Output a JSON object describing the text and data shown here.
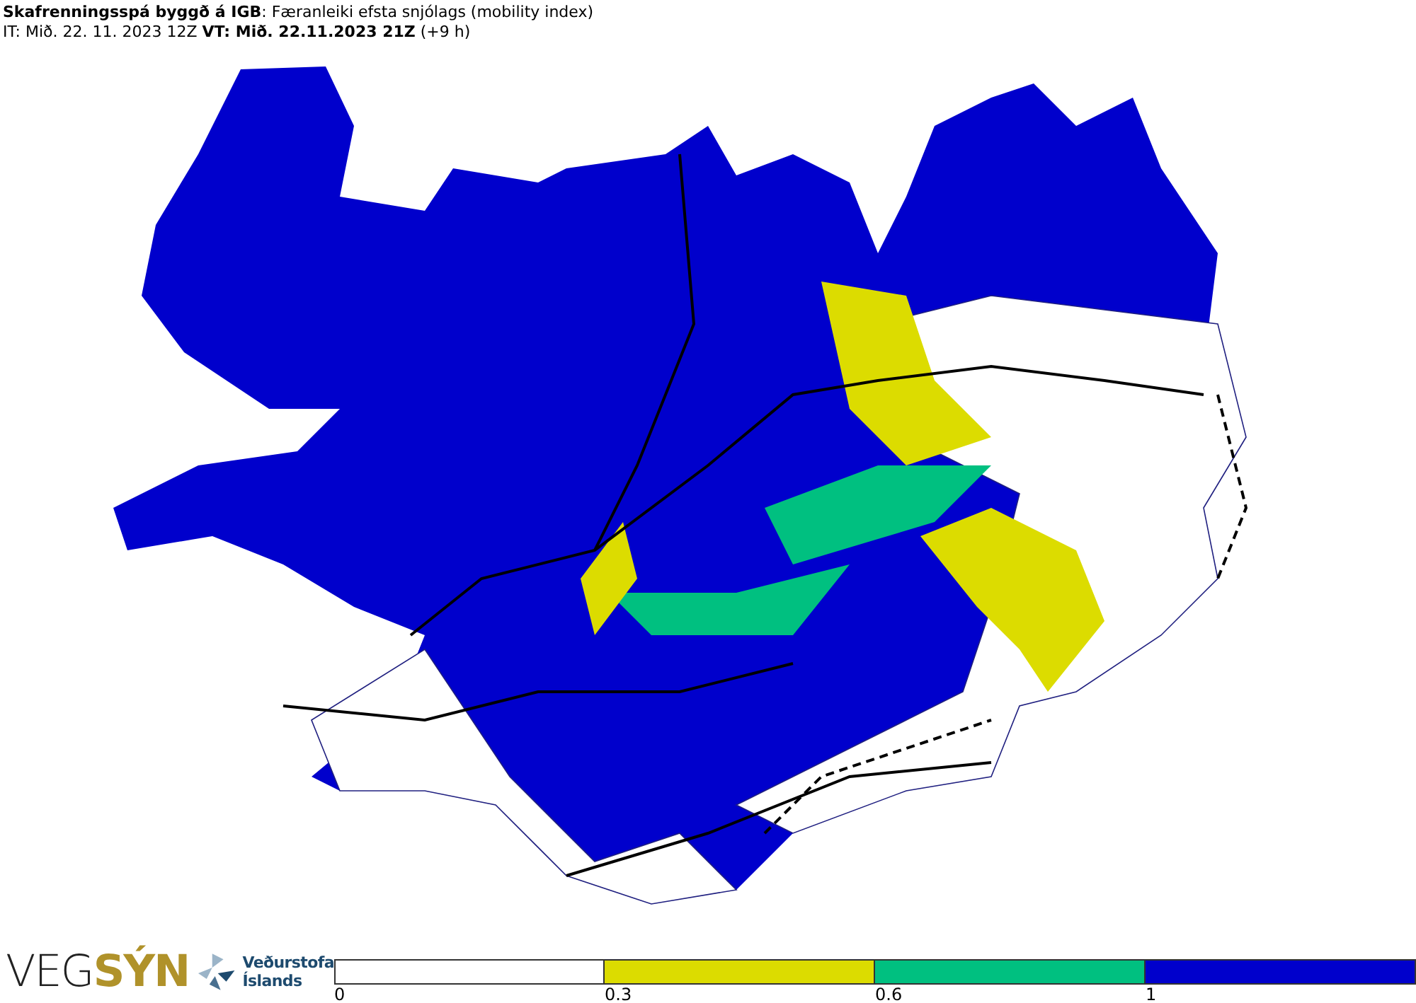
{
  "header": {
    "title": "**Skafrenningsspá byggð á IGB**: Færanleiki efsta snjólags (mobility index)",
    "times": "IT: Mið. 22. 11. 2023 12Z **VT: Mið. 22.11.2023 21Z** (+9 h)"
  },
  "logos": {
    "vegsyn": [
      "VEG",
      "SÝN"
    ],
    "vedurstofa": [
      "Veðurstofa",
      "Íslands"
    ]
  },
  "legend": [
    {
      "label": "0",
      "color": "#ffffff"
    },
    {
      "label": "0.3",
      "color": "#dcdc00"
    },
    {
      "label": "0.6",
      "color": "#00c080"
    },
    {
      "label": "1",
      "color": "#0000cc"
    }
  ]
}
